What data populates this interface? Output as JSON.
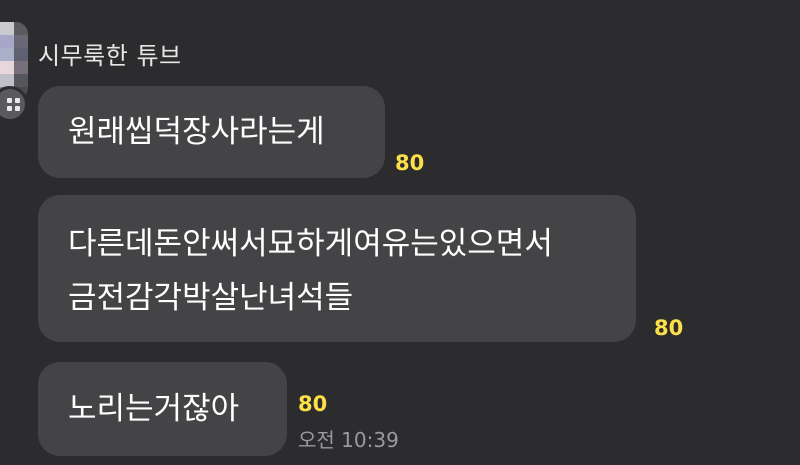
{
  "chat": {
    "sender_name": "시무룩한 튜브",
    "messages": [
      {
        "lines": [
          "원래씹덕장사라는게"
        ],
        "unread_count": "80"
      },
      {
        "lines": [
          "다른데돈안써서묘하게여유는있으면서",
          "금전감각박살난녀석들"
        ],
        "unread_count": "80"
      },
      {
        "lines": [
          "노리는거잖아"
        ],
        "unread_count": "80",
        "time": "오전 10:39"
      }
    ]
  },
  "avatar": {
    "pixels": [
      "#d8d8dc",
      "#c9c9ce",
      "#5b5b60",
      "#b9b4d6",
      "#a9a7c9",
      "#6a6876",
      "#8f93b6",
      "#aab0c8",
      "#5f6070",
      "#d8c2d2",
      "#e7d6dc",
      "#77707a",
      "#cfd0d6",
      "#bfc0c8",
      "#55565c",
      "#9a9ba2",
      "#8a8b90",
      "#4a4a4e"
    ]
  }
}
